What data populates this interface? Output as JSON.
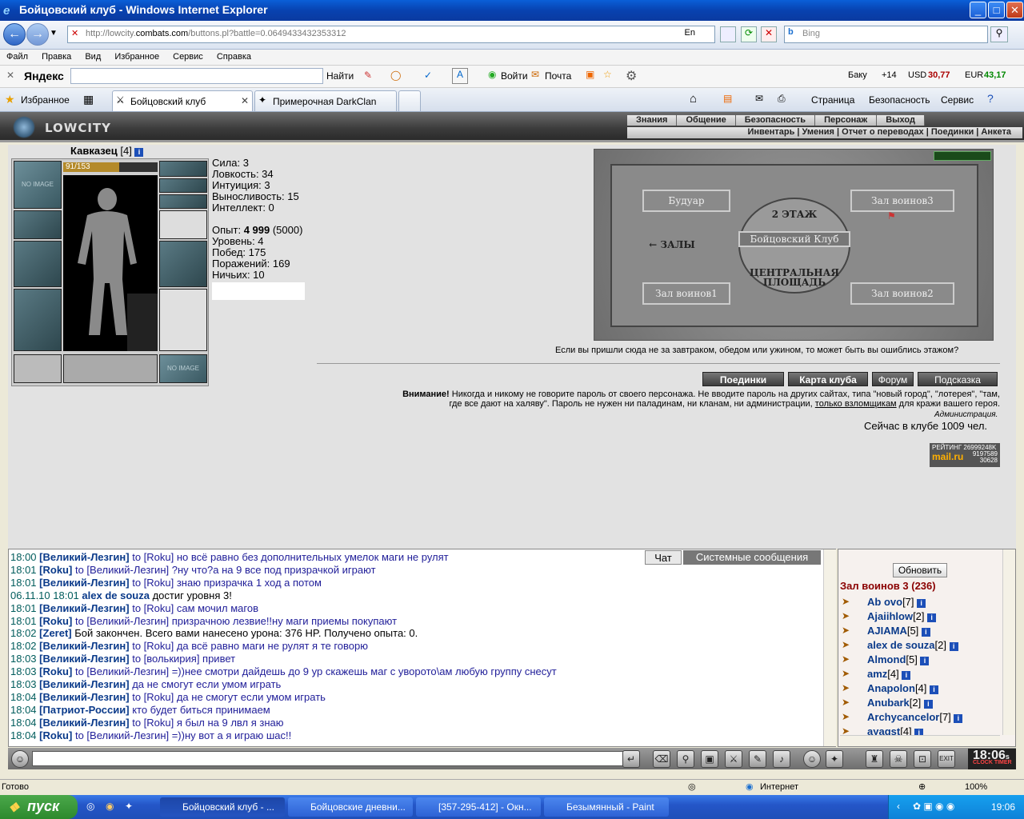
{
  "window": {
    "title": "Бойцовский клуб - Windows Internet Explorer"
  },
  "address": {
    "url_prefix": "http://lowcity.",
    "url_domain": "combats.com",
    "url_path": "/buttons.pl?battle=0.0649433432353312",
    "lang": "En",
    "search_placeholder": "Bing"
  },
  "menu": [
    "Файл",
    "Правка",
    "Вид",
    "Избранное",
    "Сервис",
    "Справка"
  ],
  "yandex": {
    "logo": "Яндекс",
    "find": "Найти",
    "login": "Войти",
    "mail": "Почта",
    "city": "Баку",
    "temp": "+14",
    "usd_label": "USD",
    "usd": "30,77",
    "eur_label": "EUR",
    "eur": "43,17"
  },
  "tabs": {
    "favorites": "Избранное",
    "tab1": "Бойцовский клуб",
    "tab2": "Примерочная DarkClan",
    "page": "Страница",
    "security": "Безопасность",
    "service": "Сервис"
  },
  "game_nav": {
    "top": [
      "Знания",
      "Общение",
      "Безопасность",
      "Персонаж",
      "Выход"
    ],
    "sub": "Инвентарь | Умения | Отчет о переводах | Поединки | Анкета",
    "logo": "LOWCITY"
  },
  "character": {
    "name": "Кавказец",
    "level": "[4]",
    "hp": "91/153",
    "hp_fraction": 0.59,
    "noimage": "NO IMAGE",
    "stats": [
      "Сила: 3",
      "Ловкость: 34",
      "Интуиция: 3",
      "Выносливость: 15",
      "Интеллект: 0"
    ],
    "exp_label": "Опыт: ",
    "exp_value": "4 999",
    "exp_next": " (5000)",
    "progress": [
      "Уровень: 4",
      "Побед: 175",
      "Поражений: 169",
      "Ничьих: 10"
    ]
  },
  "map": {
    "rooms": {
      "boudoir": "Будуар",
      "hall3": "Зал воинов3",
      "floor": "2 ЭТАЖ",
      "club": "Бойцовский Клуб",
      "halls": "← ЗАЛЫ",
      "square": "ЦЕНТРАЛЬНАЯ ПЛОЩАДЬ",
      "hall1": "Зал воинов1",
      "hall2": "Зал воинов2"
    },
    "hint": "Если вы пришли сюда не за завтраком, обедом или ужином, то может быть вы ошиблись этажом?"
  },
  "buttons": {
    "fights": "Поединки",
    "clubmap": "Карта клуба",
    "forum": "Форум",
    "hint": "Подсказка"
  },
  "warning": {
    "bold": "Внимание!",
    "text1": " Никогда и никому не говорите пароль от своего персонажа. Не вводите пароль на других сайтах, типа \"новый город\", \"лотерея\", \"там,",
    "text2a": "где все дают на халяву\". Пароль не нужен ни паладинам, ни кланам, ни администрации, ",
    "link": "только взломщикам",
    "text2b": " для кражи вашего героя.",
    "admin": "Администрация.",
    "online": "Сейчас в клубе 1009 чел."
  },
  "rating": {
    "label": "РЕЙТИНГ",
    "value1": "26999248K",
    "site": "mail.ru",
    "value2": "9197589",
    "value3": "30628"
  },
  "chat": {
    "tabs": {
      "chat": "Чат",
      "system": "Системные сообщения"
    },
    "lines": [
      {
        "time": "18:00",
        "nick": "[Великий-Лезгин]",
        "msg": " to [Roku] но всё равно без дополнительных умелок маги не рулят"
      },
      {
        "time": "18:01",
        "nick": "[Roku]",
        "msg": " to [Великий-Лезгин] ?ну что?а на 9 все под призрачкой играют"
      },
      {
        "time": "18:01",
        "nick": "[Великий-Лезгин]",
        "msg": " to [Roku] знаю призрачка 1 ход а потом"
      },
      {
        "time": "06.11.10 18:01",
        "nick": "alex de souza",
        "msg": " достиг уровня 3!"
      },
      {
        "time": "18:01",
        "nick": "[Великий-Лезгин]",
        "msg": " to [Roku] сам мочил магов"
      },
      {
        "time": "18:01",
        "nick": "[Roku]",
        "msg": " to [Великий-Лезгин] призрачною лезвие!!ну маги приемы покупают"
      },
      {
        "time": "18:02",
        "nick": "[Zeret]",
        "msg": " Бой закончен. Всего вами нанесено урона: 376 HP. Получено опыта: 0."
      },
      {
        "time": "18:02",
        "nick": "[Великий-Лезгин]",
        "msg": " to [Roku] да всё равно маги не рулят я те говорю"
      },
      {
        "time": "18:03",
        "nick": "[Великий-Лезгин]",
        "msg": " to [волькирия] привет"
      },
      {
        "time": "18:03",
        "nick": "[Roku]",
        "msg": " to [Великий-Лезгин] =))нее смотри дайдешь до 9 ур скажешь маг с уворото\\ам любую группу снесут"
      },
      {
        "time": "18:03",
        "nick": "[Великий-Лезгин]",
        "msg": " да не смогут если умом играть"
      },
      {
        "time": "18:04",
        "nick": "[Великий-Лезгин]",
        "msg": " to [Roku] да не смогут если умом играть"
      },
      {
        "time": "18:04",
        "nick": "[Патриот-России]",
        "msg": " кто будет биться принимаем"
      },
      {
        "time": "18:04",
        "nick": "[Великий-Лезгин]",
        "msg": " to [Roku] я был на 9 лвл я знаю"
      },
      {
        "time": "18:04",
        "nick": "[Roku]",
        "msg": " to [Великий-Лезгин] =))ну вот а я играю шас!!"
      }
    ]
  },
  "sidebar": {
    "refresh": "Обновить",
    "room": "Зал воинов 3 (236)",
    "users": [
      {
        "name": "Ab ovo",
        "lvl": "[7]"
      },
      {
        "name": "Ajaiihlow",
        "lvl": "[2]"
      },
      {
        "name": "AJIAMA",
        "lvl": "[5]"
      },
      {
        "name": "alex de souza",
        "lvl": "[2]"
      },
      {
        "name": "Almond",
        "lvl": "[5]"
      },
      {
        "name": "amz",
        "lvl": "[4]"
      },
      {
        "name": "Anapolon",
        "lvl": "[4]"
      },
      {
        "name": "Anubark",
        "lvl": "[2]"
      },
      {
        "name": "Archycancelor",
        "lvl": "[7]"
      },
      {
        "name": "ayagst",
        "lvl": "[4]"
      }
    ]
  },
  "clock": {
    "time": "18:06",
    "s": "s",
    "labels": "CLOCK TIMER"
  },
  "status": {
    "ready": "Готово",
    "zone": "Интернет",
    "zoom": "100%"
  },
  "taskbar": {
    "start": "пуск",
    "tasks": [
      "Бойцовский клуб - ...",
      "Бойцовские дневни...",
      "[357-295-412] - Окн...",
      "Безымянный - Paint"
    ],
    "lang": "RU",
    "time": "19:06"
  }
}
